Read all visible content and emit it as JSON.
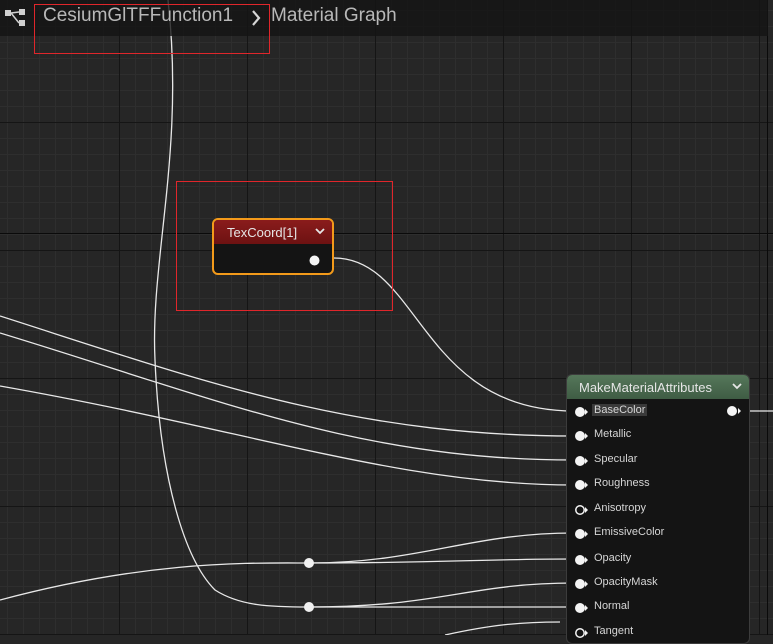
{
  "breadcrumb": {
    "items": [
      "CesiumGlTFFunction1",
      "Material Graph"
    ]
  },
  "nodes": {
    "texcoord": {
      "title": "TexCoord[1]",
      "header_color": "#7a1717",
      "selection_color": "#f39a1a"
    },
    "make_material_attributes": {
      "title": "MakeMaterialAttributes",
      "header_color": "#4b6b50",
      "inputs": [
        {
          "label": "BaseColor",
          "connected": true
        },
        {
          "label": "Metallic",
          "connected": true
        },
        {
          "label": "Specular",
          "connected": true
        },
        {
          "label": "Roughness",
          "connected": true
        },
        {
          "label": "Anisotropy",
          "connected": false
        },
        {
          "label": "EmissiveColor",
          "connected": true
        },
        {
          "label": "Opacity",
          "connected": true
        },
        {
          "label": "OpacityMask",
          "connected": true
        },
        {
          "label": "Normal",
          "connected": true
        },
        {
          "label": "Tangent",
          "connected": false
        }
      ]
    }
  },
  "icons": {
    "graph": "graph-hierarchy-icon",
    "separator": "chevron-right-icon",
    "collapse": "chevron-down-icon"
  },
  "colors": {
    "highlight_box": "#e0262b",
    "wire": "#e8e8e8",
    "canvas": "#262626"
  }
}
